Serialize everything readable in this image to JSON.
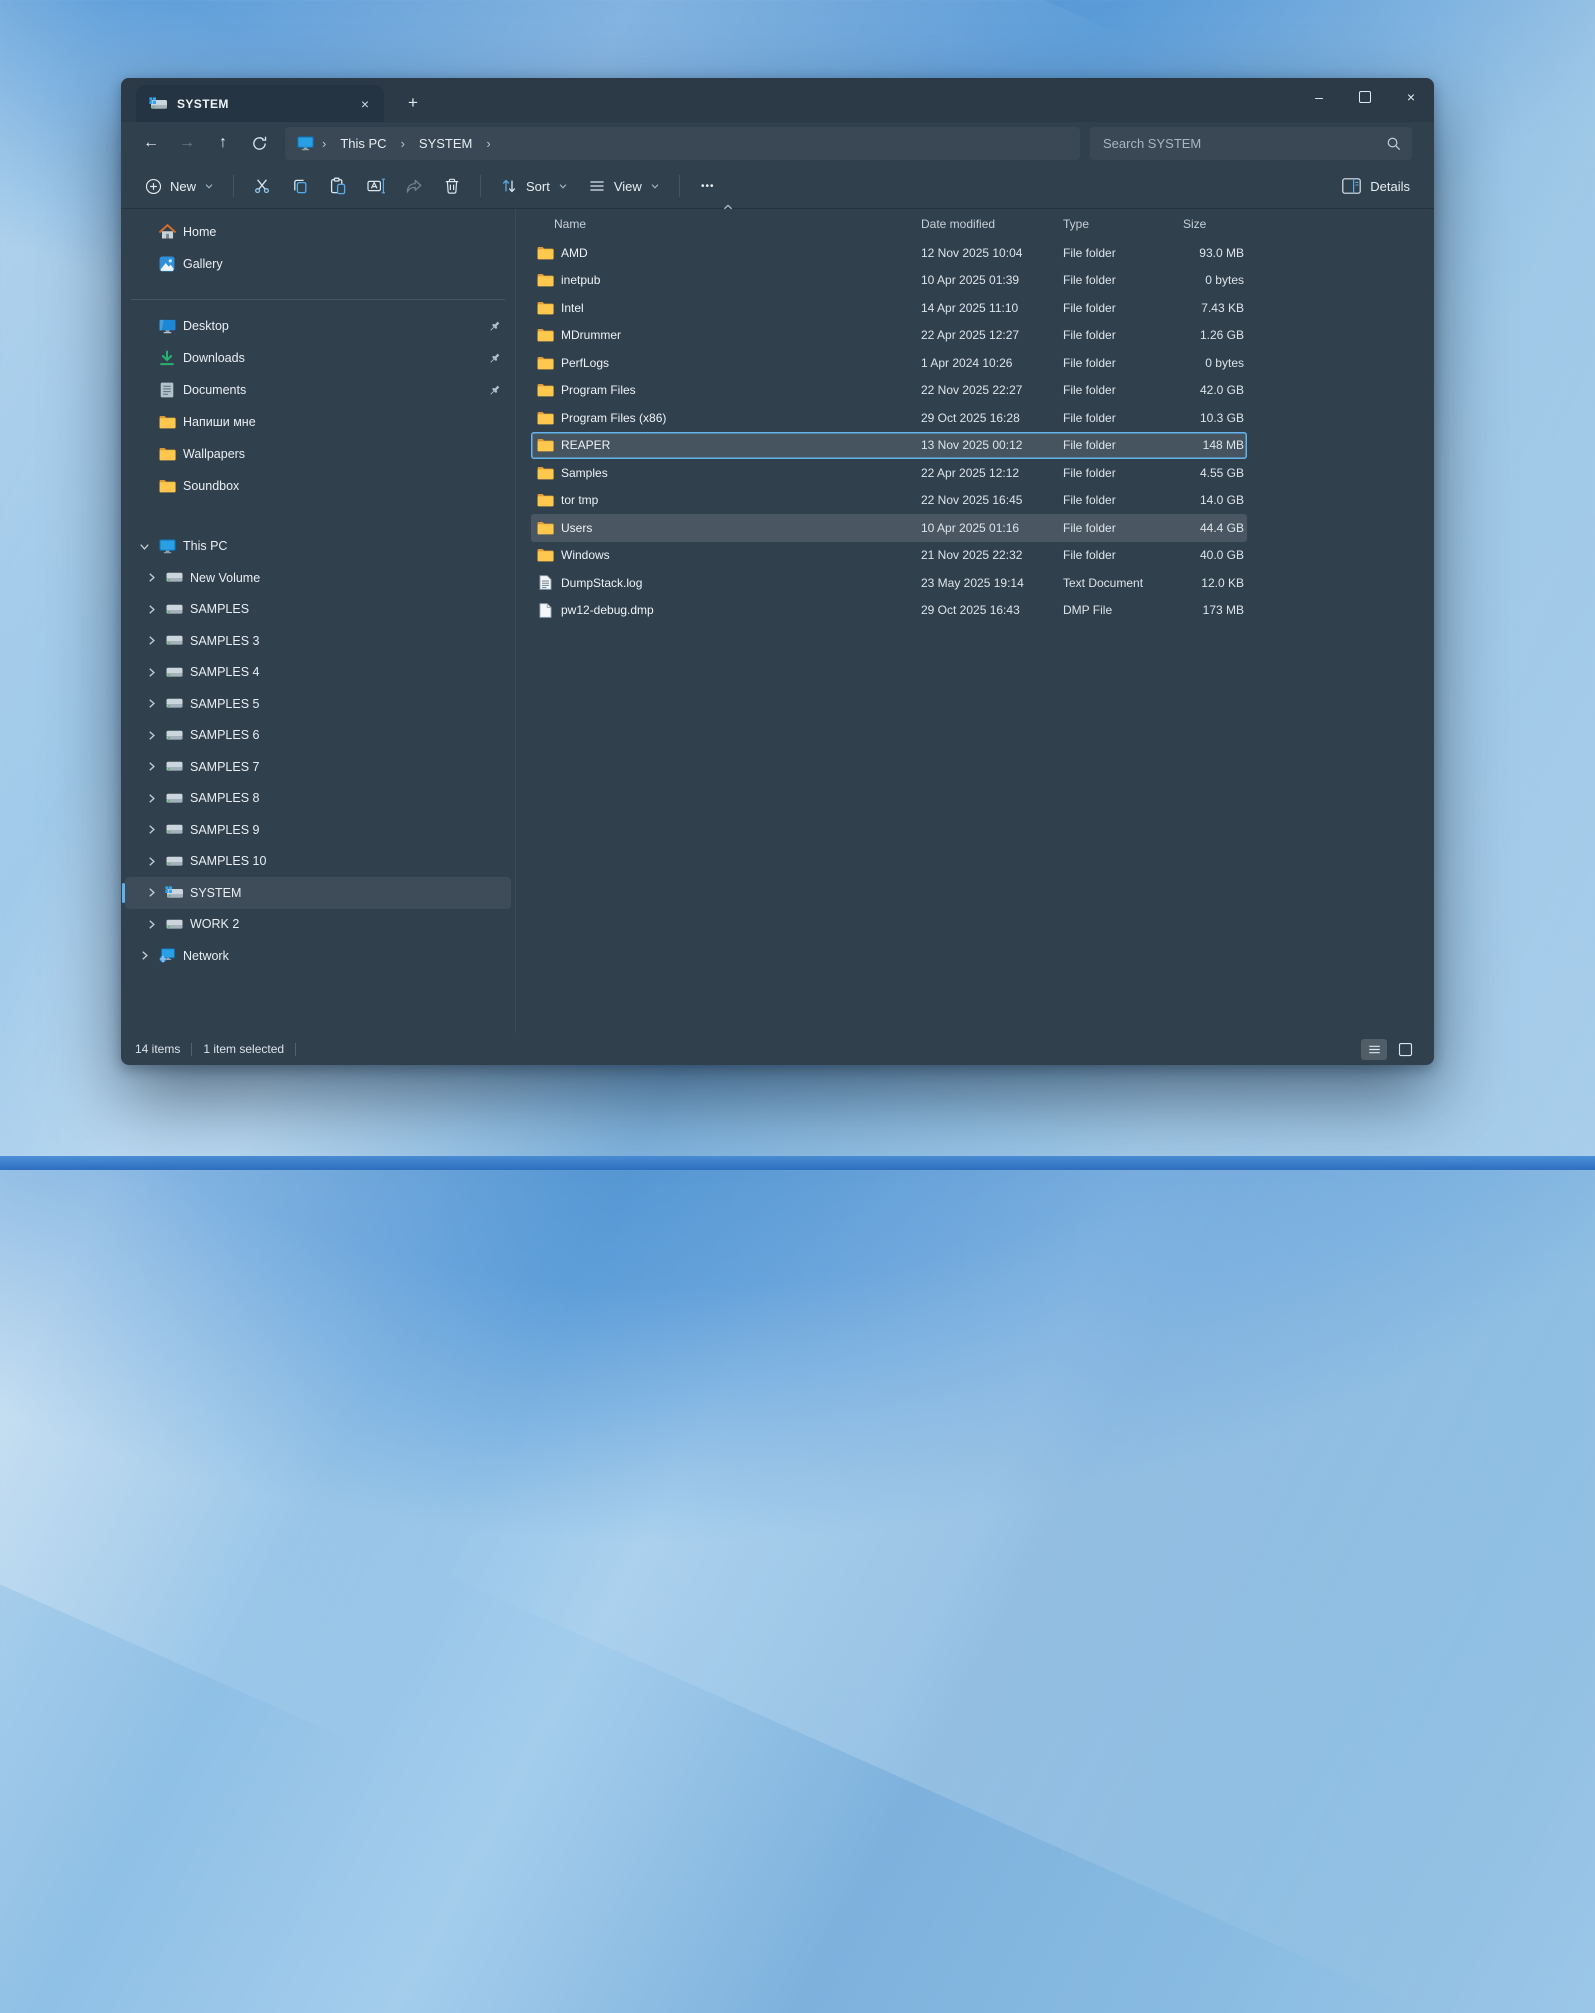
{
  "glyphs": {
    "back": "←",
    "forward": "→",
    "up": "↑",
    "new_tab": "+",
    "tab_close": "×",
    "win_minimize": "–",
    "win_close": "×",
    "more": "•••",
    "crumb_sep": "›"
  },
  "tab": {
    "title": "SYSTEM"
  },
  "breadcrumb": {
    "items": [
      "This PC",
      "SYSTEM"
    ]
  },
  "search": {
    "placeholder": "Search SYSTEM"
  },
  "commandbar": {
    "new": "New",
    "sort": "Sort",
    "view": "View",
    "details": "Details"
  },
  "sidebar": {
    "top": [
      {
        "label": "Home",
        "icon": "home"
      },
      {
        "label": "Gallery",
        "icon": "gallery"
      }
    ],
    "quick": [
      {
        "label": "Desktop",
        "icon": "desktop",
        "pinned": true
      },
      {
        "label": "Downloads",
        "icon": "downloads",
        "pinned": true
      },
      {
        "label": "Documents",
        "icon": "documents",
        "pinned": true
      },
      {
        "label": "Напиши мне",
        "icon": "folder",
        "pinned": false
      },
      {
        "label": "Wallpapers",
        "icon": "folder",
        "pinned": false
      },
      {
        "label": "Soundbox",
        "icon": "folder",
        "pinned": false
      }
    ],
    "this_pc": {
      "label": "This PC"
    },
    "drives": [
      {
        "label": "New Volume"
      },
      {
        "label": "SAMPLES"
      },
      {
        "label": "SAMPLES 3"
      },
      {
        "label": "SAMPLES 4"
      },
      {
        "label": "SAMPLES 5"
      },
      {
        "label": "SAMPLES 6"
      },
      {
        "label": "SAMPLES 7"
      },
      {
        "label": "SAMPLES 8"
      },
      {
        "label": "SAMPLES 9"
      },
      {
        "label": "SAMPLES 10"
      },
      {
        "label": "SYSTEM",
        "selected": true,
        "system": true
      },
      {
        "label": "WORK 2"
      }
    ],
    "network": {
      "label": "Network"
    }
  },
  "files": {
    "columns": {
      "name": "Name",
      "date": "Date modified",
      "type": "Type",
      "size": "Size"
    },
    "rows": [
      {
        "name": "AMD",
        "date": "12 Nov 2025 10:04",
        "type": "File folder",
        "size": "93.0 MB",
        "icon": "folder"
      },
      {
        "name": "inetpub",
        "date": "10 Apr 2025 01:39",
        "type": "File folder",
        "size": "0 bytes",
        "icon": "folder"
      },
      {
        "name": "Intel",
        "date": "14 Apr 2025 11:10",
        "type": "File folder",
        "size": "7.43 KB",
        "icon": "folder"
      },
      {
        "name": "MDrummer",
        "date": "22 Apr 2025 12:27",
        "type": "File folder",
        "size": "1.26 GB",
        "icon": "folder"
      },
      {
        "name": "PerfLogs",
        "date": "1 Apr 2024 10:26",
        "type": "File folder",
        "size": "0 bytes",
        "icon": "folder"
      },
      {
        "name": "Program Files",
        "date": "22 Nov 2025 22:27",
        "type": "File folder",
        "size": "42.0 GB",
        "icon": "folder"
      },
      {
        "name": "Program Files (x86)",
        "date": "29 Oct 2025 16:28",
        "type": "File folder",
        "size": "10.3 GB",
        "icon": "folder"
      },
      {
        "name": "REAPER",
        "date": "13 Nov 2025 00:12",
        "type": "File folder",
        "size": "148 MB",
        "icon": "folder",
        "state": "selected"
      },
      {
        "name": "Samples",
        "date": "22 Apr 2025 12:12",
        "type": "File folder",
        "size": "4.55 GB",
        "icon": "folder"
      },
      {
        "name": "tor tmp",
        "date": "22 Nov 2025 16:45",
        "type": "File folder",
        "size": "14.0 GB",
        "icon": "folder"
      },
      {
        "name": "Users",
        "date": "10 Apr 2025 01:16",
        "type": "File folder",
        "size": "44.4 GB",
        "icon": "folder",
        "state": "hover"
      },
      {
        "name": "Windows",
        "date": "21 Nov 2025 22:32",
        "type": "File folder",
        "size": "40.0 GB",
        "icon": "folder"
      },
      {
        "name": "DumpStack.log",
        "date": "23 May 2025 19:14",
        "type": "Text Document",
        "size": "12.0 KB",
        "icon": "fileText"
      },
      {
        "name": "pw12-debug.dmp",
        "date": "29 Oct 2025 16:43",
        "type": "DMP File",
        "size": "173 MB",
        "icon": "fileBlank"
      }
    ]
  },
  "statusbar": {
    "count": "14 items",
    "selection": "1 item selected"
  },
  "colors": {
    "accent": "#5fb2ea",
    "selection_border": "#63b4ed",
    "folder_yellow": "#fdc84b",
    "window_bg": "#31404d"
  }
}
